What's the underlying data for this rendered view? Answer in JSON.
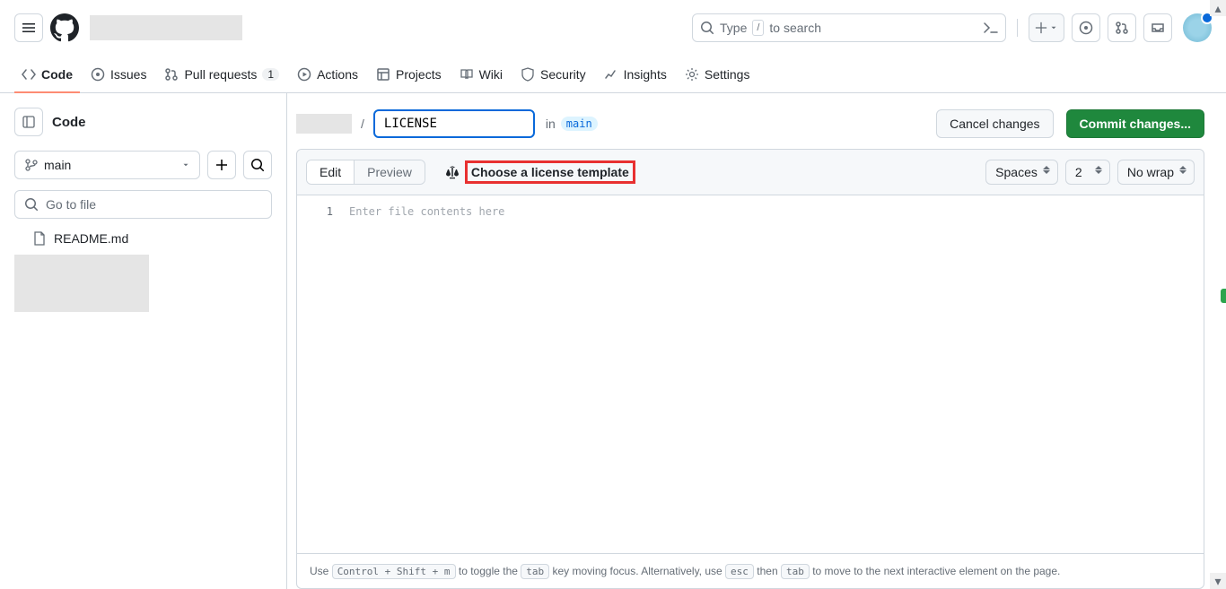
{
  "header": {
    "search_placeholder_prefix": "Type",
    "search_placeholder_suffix": "to search",
    "slash_key": "/"
  },
  "nav": {
    "code": "Code",
    "issues": "Issues",
    "pull_requests": "Pull requests",
    "pull_requests_count": "1",
    "actions": "Actions",
    "projects": "Projects",
    "wiki": "Wiki",
    "security": "Security",
    "insights": "Insights",
    "settings": "Settings"
  },
  "sidebar": {
    "title": "Code",
    "branch": "main",
    "go_to_file": "Go to file",
    "files": [
      "README.md"
    ]
  },
  "editor": {
    "filename": "LICENSE",
    "in_label": "in",
    "branch": "main",
    "cancel_label": "Cancel changes",
    "commit_label": "Commit changes...",
    "tab_edit": "Edit",
    "tab_preview": "Preview",
    "license_btn": "Choose a license template",
    "indent_mode": "Spaces",
    "indent_size": "2",
    "wrap_mode": "No wrap",
    "line_number": "1",
    "placeholder": "Enter file contents here"
  },
  "hint": {
    "p1": "Use",
    "k1": "Control + Shift + m",
    "p2": "to toggle the",
    "k2": "tab",
    "p3": "key moving focus. Alternatively, use",
    "k3": "esc",
    "p4": "then",
    "k4": "tab",
    "p5": "to move to the next interactive element on the page."
  }
}
